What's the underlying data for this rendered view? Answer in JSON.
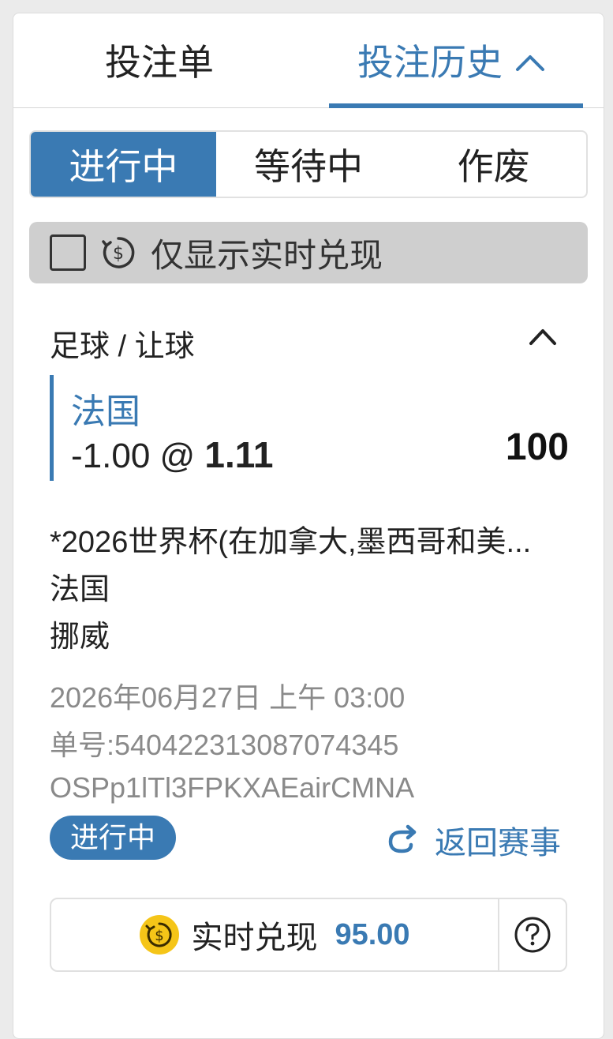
{
  "tabs": {
    "betslip": "投注单",
    "history": "投注历史"
  },
  "filters": [
    "进行中",
    "等待中",
    "作废"
  ],
  "cashout_filter": {
    "label": "仅显示实时兑现",
    "checked": false
  },
  "bet": {
    "type": "足球 / 让球",
    "selection_team": "法国",
    "handicap": "-1.00 @ ",
    "odds": "1.11",
    "stake": "100",
    "competition": "*2026世界杯(在加拿大,墨西哥和美...",
    "home_team": "法国",
    "away_team": "挪威",
    "datetime": "2026年06月27日 上午 03:00",
    "bet_number": "单号:5404223130870743​45",
    "ref_code": "OSPp1lTl3FPKXAEairCMNA",
    "status": "进行中",
    "back_link": "返回赛事",
    "cashout_label": "实时兑现",
    "cashout_amount": "95.00"
  },
  "colors": {
    "accent": "#3a7ab3",
    "coin": "#f5c518",
    "toggle_bg": "#cfcfcf"
  },
  "icons": [
    "chevron-up-icon",
    "checkbox-icon",
    "cashout-coin-icon",
    "return-arrow-icon",
    "help-icon"
  ]
}
